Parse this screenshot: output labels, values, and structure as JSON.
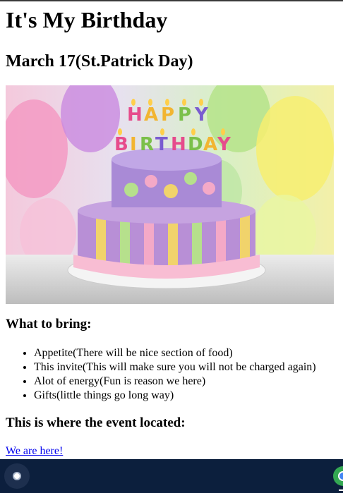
{
  "page": {
    "title": "It's My Birthday",
    "date_heading": "March 17(St.Patrick Day)",
    "image_alt": "Happy Birthday cake",
    "bring_heading": "What to bring:",
    "bring_items": [
      "Appetite(There will be nice section of food)",
      "This invite(This will make sure you will not be charged again)",
      "Alot of energy(Fun is reason we here)",
      "Gifts(little things go long way)"
    ],
    "location_heading": "This is where the event located:",
    "location_link": "We are here!"
  },
  "taskbar": {
    "launcher_icon": "launcher-icon",
    "pinned_app_icon": "chrome-icon"
  },
  "colors": {
    "link": "#0000ee",
    "taskbar": "#0c1f3d"
  }
}
